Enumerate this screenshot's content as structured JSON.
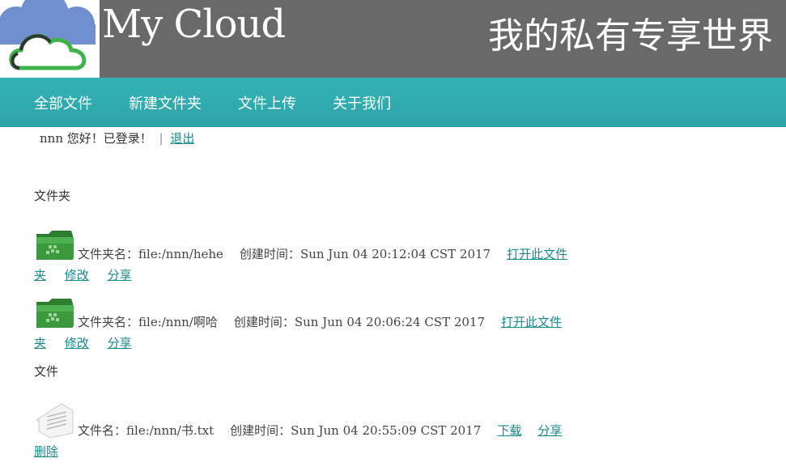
{
  "header": {
    "title": "My Cloud",
    "slogan": "我的私有专享世界",
    "colors": {
      "bar": "#696969",
      "cloud_blue": "#6f8fcf",
      "cloud_green": "#3db34a"
    }
  },
  "nav": {
    "items": [
      "全部文件",
      "新建文件夹",
      "文件上传",
      "关于我们"
    ],
    "color": "#33b2b6"
  },
  "user": {
    "greeting": "nnn 您好！已登录！",
    "separator": "|",
    "logout": "退出"
  },
  "folders_label": "文件夹",
  "folders": [
    {
      "name_label": "文件夹名：",
      "name": "file:/nnn/hehe",
      "time_label": "创建时间：",
      "time": "Sun Jun 04 20:12:04 CST 2017",
      "open_part1": "打开此文件",
      "open_part2": "夹",
      "edit": "修改",
      "share": "分享"
    },
    {
      "name_label": "文件夹名：",
      "name": "file:/nnn/啊哈",
      "time_label": "创建时间：",
      "time": "Sun Jun 04 20:06:24 CST 2017",
      "open_part1": "打开此文件",
      "open_part2": "夹",
      "edit": "修改",
      "share": "分享"
    }
  ],
  "files_label": "文件",
  "files": [
    {
      "name_label": "文件名：",
      "name": "file:/nnn/书.txt",
      "time_label": "创建时间：",
      "time": "Sun Jun 04 20:55:09 CST 2017",
      "download": "下载",
      "share": "分享",
      "delete": "删除"
    }
  ],
  "link_color": "#1a8a8d"
}
